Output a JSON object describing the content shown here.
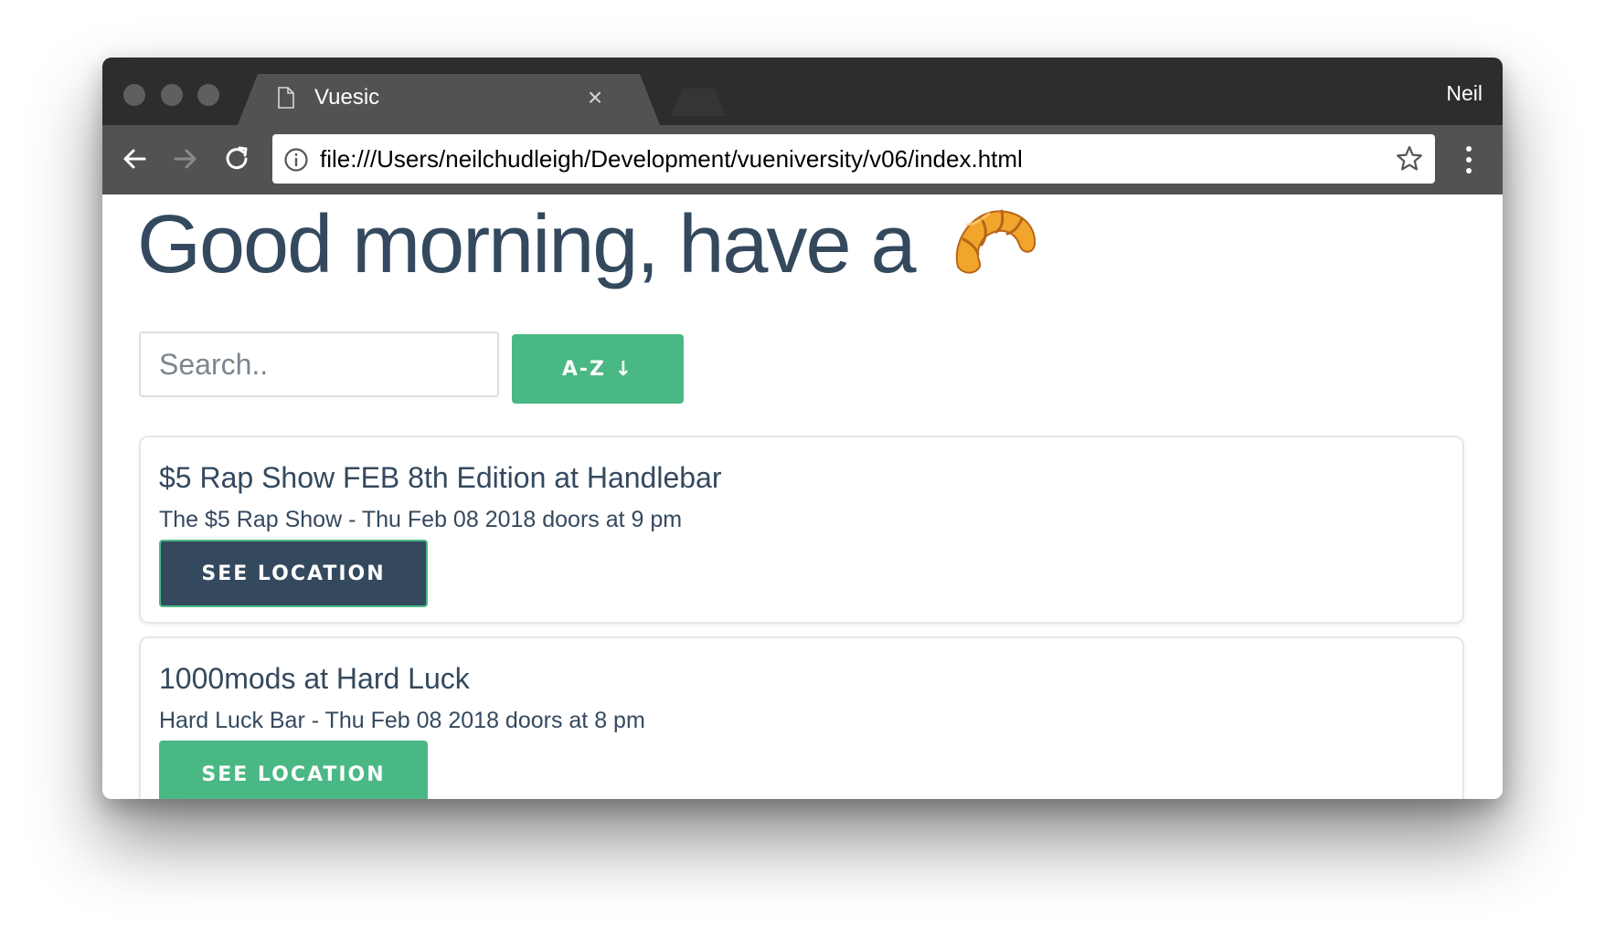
{
  "browser": {
    "tab_title": "Vuesic",
    "tab_close": "×",
    "profile_name": "Neil",
    "url": "file:///Users/neilchudleigh/Development/vueniversity/v06/index.html"
  },
  "page": {
    "greeting": "Good morning, have a",
    "greeting_emoji": "croissant-icon",
    "search_placeholder": "Search..",
    "sort_label": "A-Z ↓",
    "events": [
      {
        "title": "$5 Rap Show FEB 8th Edition at Handlebar",
        "meta": "The $5 Rap Show - Thu Feb 08 2018 doors at 9 pm",
        "button_label": "SEE LOCATION",
        "button_state": "active"
      },
      {
        "title": "1000mods at Hard Luck",
        "meta": "Hard Luck Bar - Thu Feb 08 2018 doors at 8 pm",
        "button_label": "SEE LOCATION",
        "button_state": "default"
      }
    ]
  },
  "colors": {
    "primary_text": "#34495e",
    "accent_green": "#4ab884",
    "active_button": "#34495e"
  }
}
